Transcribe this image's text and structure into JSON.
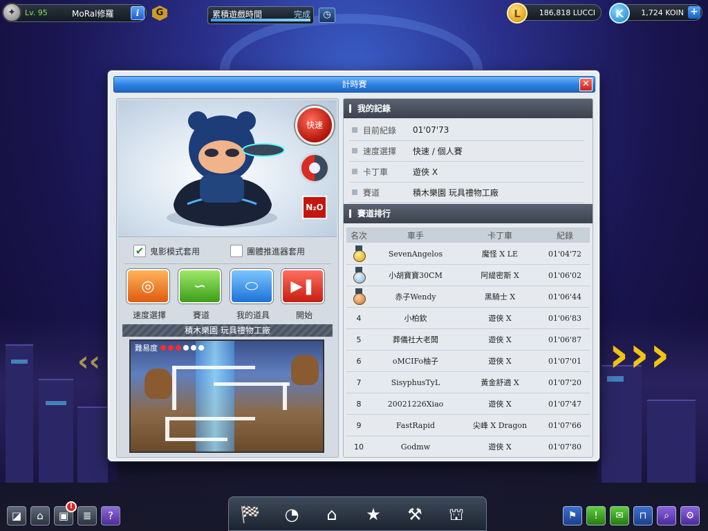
{
  "player": {
    "level": "Lv. 95",
    "name": "MoRal修羅"
  },
  "quest": {
    "label": "累積遊戲時間",
    "status": "完成",
    "progress": 1.0
  },
  "currency": {
    "lucci": "186,818 LUCCI",
    "koin": "1,724 KOIN"
  },
  "dialog": {
    "title": "計時賽",
    "speed_badge": "快速",
    "options": {
      "ghost_mode": "鬼影模式套用",
      "ghost_checked": true,
      "team_booster": "團體推進器套用",
      "team_checked": false
    },
    "buttons": {
      "speed_select": "速度選擇",
      "track": "賽道",
      "my_items": "我的道具",
      "start": "開始"
    },
    "track_name": "積木樂園  玩具禮物工廠",
    "difficulty_label": "難易度",
    "difficulty_level": 3,
    "difficulty_max": 6
  },
  "my_record": {
    "header": "我的記錄",
    "rows": [
      {
        "label": "目前紀錄",
        "value": "01'07'73"
      },
      {
        "label": "速度選擇",
        "value": "快速 / 個人賽"
      },
      {
        "label": "卡丁車",
        "value": "遊俠 X"
      },
      {
        "label": "賽道",
        "value": "積木樂園  玩具禮物工廠"
      }
    ]
  },
  "ranking": {
    "header": "賽道排行",
    "columns": {
      "rank": "名次",
      "driver": "車手",
      "kart": "卡丁車",
      "time": "紀錄"
    },
    "rows": [
      {
        "rank": "1",
        "medal": "gold",
        "driver": "SevenAngelos",
        "kart": "魔怪 X LE",
        "time": "01'04'72"
      },
      {
        "rank": "2",
        "medal": "silver",
        "driver": "小胡寶寶30CM",
        "kart": "阿緹密斯 X",
        "time": "01'06'02"
      },
      {
        "rank": "3",
        "medal": "bronze",
        "driver": "赤子Wendy",
        "kart": "黑騎士 X",
        "time": "01'06'44"
      },
      {
        "rank": "4",
        "medal": "",
        "driver": "小柏欽",
        "kart": "遊俠 X",
        "time": "01'06'83"
      },
      {
        "rank": "5",
        "medal": "",
        "driver": "葬儀社大老闆",
        "kart": "遊俠 X",
        "time": "01'06'87"
      },
      {
        "rank": "6",
        "medal": "",
        "driver": "oMCIFo柚子",
        "kart": "遊俠 X",
        "time": "01'07'01"
      },
      {
        "rank": "7",
        "medal": "",
        "driver": "SisyphusTyL",
        "kart": "黃金舒適 X",
        "time": "01'07'20"
      },
      {
        "rank": "8",
        "medal": "",
        "driver": "20021226Xiao",
        "kart": "遊俠 X",
        "time": "01'07'47"
      },
      {
        "rank": "9",
        "medal": "",
        "driver": "FastRapid",
        "kart": "尖峰 X Dragon",
        "time": "01'07'66"
      },
      {
        "rank": "10",
        "medal": "",
        "driver": "Godmw",
        "kart": "遊俠 X",
        "time": "01'07'80"
      }
    ]
  },
  "icons": {
    "bottom_left": [
      "screenshot-icon",
      "home-icon",
      "inventory-icon",
      "notes-icon",
      "help-icon"
    ],
    "bottom_center": [
      "kart-garage-icon",
      "speedometer-icon",
      "garage-icon",
      "shop-icon",
      "toolbox-icon",
      "tower-icon"
    ],
    "bottom_right": [
      "flag-icon",
      "alert-icon",
      "chat-icon",
      "mailbox-icon",
      "search-icon",
      "settings-icon"
    ]
  },
  "notification_badge": "!"
}
